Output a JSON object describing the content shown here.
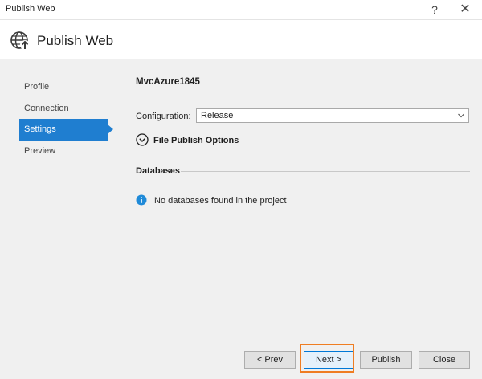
{
  "window": {
    "title": "Publish Web",
    "help_icon": "?",
    "close_icon": "✕"
  },
  "header": {
    "title": "Publish Web",
    "icon": "globe-publish-icon"
  },
  "nav": {
    "items": [
      {
        "label": "Profile"
      },
      {
        "label": "Connection"
      },
      {
        "label": "Settings"
      },
      {
        "label": "Preview"
      }
    ],
    "active": "Settings"
  },
  "settings": {
    "profile_name": "MvcAzure1845",
    "configuration_label_underlined": "C",
    "configuration_label_rest": "onfiguration:",
    "configuration_value": "Release",
    "file_publish_options_label": "File Publish Options",
    "databases_title": "Databases",
    "databases_message": "No databases found in the project"
  },
  "footer": {
    "prev_label": "< Prev",
    "next_label": "Next >",
    "publish_label": "Publish",
    "close_label": "Close"
  },
  "colors": {
    "accent": "#1f7ed0",
    "highlight": "#ef7d22",
    "info": "#1f8ad8"
  }
}
